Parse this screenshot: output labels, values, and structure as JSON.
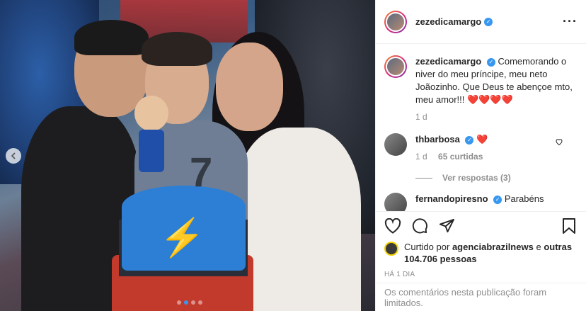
{
  "post": {
    "username": "zezedicamargo",
    "more_icon": "more-horizontal-icon"
  },
  "caption": {
    "username": "zezedicamargo",
    "text": "Comemorando o niver do meu príncipe, meu neto Joãozinho. Que Deus te abençoe mto, meu amor!!!",
    "hearts": "❤️❤️❤️❤️",
    "age": "1 d"
  },
  "comment": {
    "username": "thbarbosa",
    "text": "❤️",
    "age": "1 d",
    "likes": "65 curtidas",
    "view_replies": "Ver respostas (3)"
  },
  "partial_comment": {
    "username": "fernandopiresno",
    "text": "Parabéns"
  },
  "likes": {
    "prefix": "Curtido por",
    "user": "agenciabrazilnews",
    "connector": "e",
    "others": "outras 104.706 pessoas"
  },
  "time_ago": "HÁ 1 DIA",
  "comments_limited": "Os comentários nesta publicação foram limitados.",
  "carousel": {
    "count": 4,
    "active_index": 1
  }
}
